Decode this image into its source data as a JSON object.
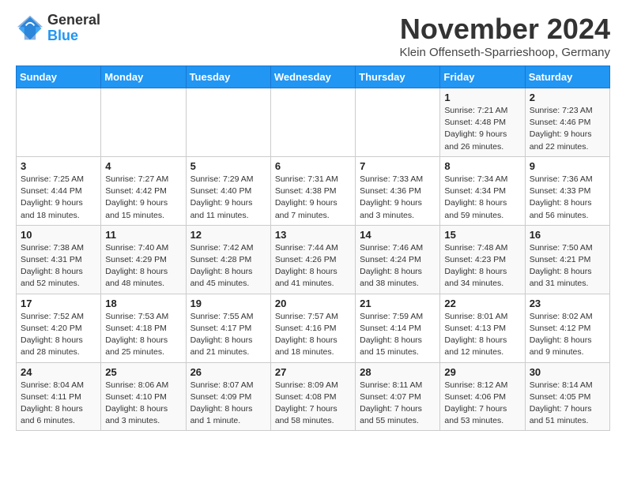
{
  "logo": {
    "general": "General",
    "blue": "Blue"
  },
  "title": "November 2024",
  "subtitle": "Klein Offenseth-Sparrieshoop, Germany",
  "weekdays": [
    "Sunday",
    "Monday",
    "Tuesday",
    "Wednesday",
    "Thursday",
    "Friday",
    "Saturday"
  ],
  "weeks": [
    [
      {
        "day": "",
        "info": ""
      },
      {
        "day": "",
        "info": ""
      },
      {
        "day": "",
        "info": ""
      },
      {
        "day": "",
        "info": ""
      },
      {
        "day": "",
        "info": ""
      },
      {
        "day": "1",
        "info": "Sunrise: 7:21 AM\nSunset: 4:48 PM\nDaylight: 9 hours and 26 minutes."
      },
      {
        "day": "2",
        "info": "Sunrise: 7:23 AM\nSunset: 4:46 PM\nDaylight: 9 hours and 22 minutes."
      }
    ],
    [
      {
        "day": "3",
        "info": "Sunrise: 7:25 AM\nSunset: 4:44 PM\nDaylight: 9 hours and 18 minutes."
      },
      {
        "day": "4",
        "info": "Sunrise: 7:27 AM\nSunset: 4:42 PM\nDaylight: 9 hours and 15 minutes."
      },
      {
        "day": "5",
        "info": "Sunrise: 7:29 AM\nSunset: 4:40 PM\nDaylight: 9 hours and 11 minutes."
      },
      {
        "day": "6",
        "info": "Sunrise: 7:31 AM\nSunset: 4:38 PM\nDaylight: 9 hours and 7 minutes."
      },
      {
        "day": "7",
        "info": "Sunrise: 7:33 AM\nSunset: 4:36 PM\nDaylight: 9 hours and 3 minutes."
      },
      {
        "day": "8",
        "info": "Sunrise: 7:34 AM\nSunset: 4:34 PM\nDaylight: 8 hours and 59 minutes."
      },
      {
        "day": "9",
        "info": "Sunrise: 7:36 AM\nSunset: 4:33 PM\nDaylight: 8 hours and 56 minutes."
      }
    ],
    [
      {
        "day": "10",
        "info": "Sunrise: 7:38 AM\nSunset: 4:31 PM\nDaylight: 8 hours and 52 minutes."
      },
      {
        "day": "11",
        "info": "Sunrise: 7:40 AM\nSunset: 4:29 PM\nDaylight: 8 hours and 48 minutes."
      },
      {
        "day": "12",
        "info": "Sunrise: 7:42 AM\nSunset: 4:28 PM\nDaylight: 8 hours and 45 minutes."
      },
      {
        "day": "13",
        "info": "Sunrise: 7:44 AM\nSunset: 4:26 PM\nDaylight: 8 hours and 41 minutes."
      },
      {
        "day": "14",
        "info": "Sunrise: 7:46 AM\nSunset: 4:24 PM\nDaylight: 8 hours and 38 minutes."
      },
      {
        "day": "15",
        "info": "Sunrise: 7:48 AM\nSunset: 4:23 PM\nDaylight: 8 hours and 34 minutes."
      },
      {
        "day": "16",
        "info": "Sunrise: 7:50 AM\nSunset: 4:21 PM\nDaylight: 8 hours and 31 minutes."
      }
    ],
    [
      {
        "day": "17",
        "info": "Sunrise: 7:52 AM\nSunset: 4:20 PM\nDaylight: 8 hours and 28 minutes."
      },
      {
        "day": "18",
        "info": "Sunrise: 7:53 AM\nSunset: 4:18 PM\nDaylight: 8 hours and 25 minutes."
      },
      {
        "day": "19",
        "info": "Sunrise: 7:55 AM\nSunset: 4:17 PM\nDaylight: 8 hours and 21 minutes."
      },
      {
        "day": "20",
        "info": "Sunrise: 7:57 AM\nSunset: 4:16 PM\nDaylight: 8 hours and 18 minutes."
      },
      {
        "day": "21",
        "info": "Sunrise: 7:59 AM\nSunset: 4:14 PM\nDaylight: 8 hours and 15 minutes."
      },
      {
        "day": "22",
        "info": "Sunrise: 8:01 AM\nSunset: 4:13 PM\nDaylight: 8 hours and 12 minutes."
      },
      {
        "day": "23",
        "info": "Sunrise: 8:02 AM\nSunset: 4:12 PM\nDaylight: 8 hours and 9 minutes."
      }
    ],
    [
      {
        "day": "24",
        "info": "Sunrise: 8:04 AM\nSunset: 4:11 PM\nDaylight: 8 hours and 6 minutes."
      },
      {
        "day": "25",
        "info": "Sunrise: 8:06 AM\nSunset: 4:10 PM\nDaylight: 8 hours and 3 minutes."
      },
      {
        "day": "26",
        "info": "Sunrise: 8:07 AM\nSunset: 4:09 PM\nDaylight: 8 hours and 1 minute."
      },
      {
        "day": "27",
        "info": "Sunrise: 8:09 AM\nSunset: 4:08 PM\nDaylight: 7 hours and 58 minutes."
      },
      {
        "day": "28",
        "info": "Sunrise: 8:11 AM\nSunset: 4:07 PM\nDaylight: 7 hours and 55 minutes."
      },
      {
        "day": "29",
        "info": "Sunrise: 8:12 AM\nSunset: 4:06 PM\nDaylight: 7 hours and 53 minutes."
      },
      {
        "day": "30",
        "info": "Sunrise: 8:14 AM\nSunset: 4:05 PM\nDaylight: 7 hours and 51 minutes."
      }
    ]
  ]
}
